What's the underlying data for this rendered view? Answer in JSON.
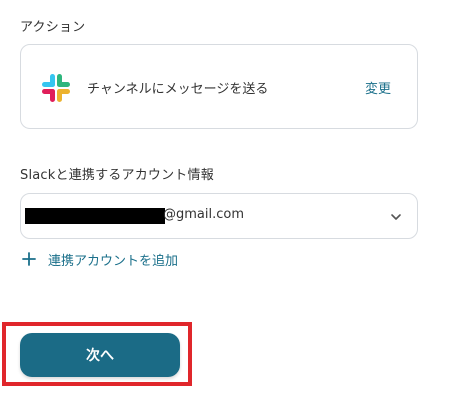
{
  "action_section": {
    "label": "アクション",
    "app_icon": "slack-icon",
    "action_name": "チャンネルにメッセージを送る",
    "change_label": "変更"
  },
  "account_section": {
    "label": "Slackと連携するアカウント情報",
    "selected_account_suffix": "@gmail.com",
    "dropdown_icon": "chevron-down-icon",
    "add_account_label": "連携アカウントを追加",
    "add_icon": "plus-icon"
  },
  "footer": {
    "next_label": "次へ"
  },
  "colors": {
    "accent": "#1a6f8a",
    "button_bg": "#1b6b86",
    "border": "#d7dbe0",
    "highlight": "#e0262b",
    "text": "#333333"
  }
}
